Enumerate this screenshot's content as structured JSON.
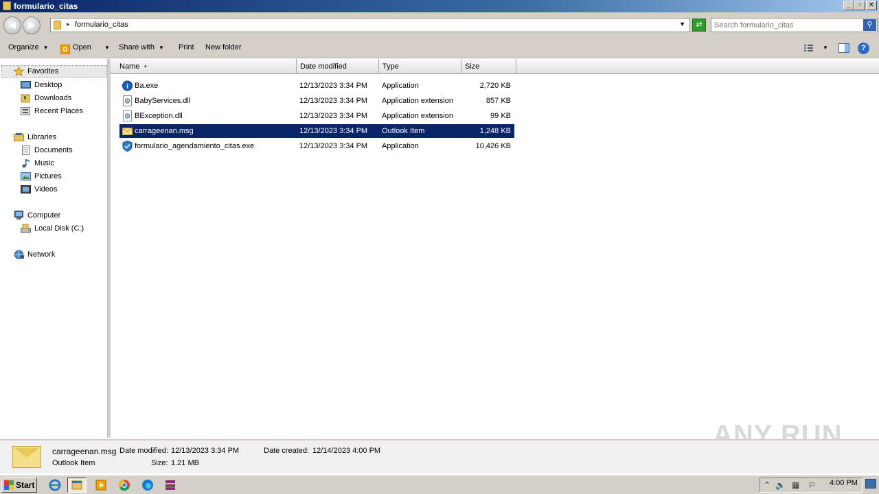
{
  "window": {
    "title": "formulario_citas",
    "buttons": {
      "minimize": "_",
      "restore": "▫",
      "close": "✕"
    }
  },
  "addressbar": {
    "path": "formulario_citas",
    "search_placeholder": "Search formulario_citas"
  },
  "toolbar": {
    "organize": "Organize",
    "open": "Open",
    "share_with": "Share with",
    "print": "Print",
    "new_folder": "New folder"
  },
  "navpane": {
    "favorites": {
      "label": "Favorites",
      "items": [
        "Desktop",
        "Downloads",
        "Recent Places"
      ]
    },
    "libraries": {
      "label": "Libraries",
      "items": [
        "Documents",
        "Music",
        "Pictures",
        "Videos"
      ]
    },
    "computer": {
      "label": "Computer",
      "items": [
        "Local Disk (C:)"
      ]
    },
    "network": {
      "label": "Network"
    }
  },
  "columns": [
    "Name",
    "Date modified",
    "Type",
    "Size"
  ],
  "files": [
    {
      "name": "Ba.exe",
      "date": "12/13/2023 3:34 PM",
      "type": "Application",
      "size": "2,720 KB",
      "icon": "exe-blue-icon"
    },
    {
      "name": "BabyServices.dll",
      "date": "12/13/2023 3:34 PM",
      "type": "Application extension",
      "size": "857 KB",
      "icon": "dll-icon"
    },
    {
      "name": "BException.dll",
      "date": "12/13/2023 3:34 PM",
      "type": "Application extension",
      "size": "99 KB",
      "icon": "dll-icon"
    },
    {
      "name": "carrageenan.msg",
      "date": "12/13/2023 3:34 PM",
      "type": "Outlook Item",
      "size": "1,248 KB",
      "icon": "mail-icon",
      "selected": true
    },
    {
      "name": "formulario_agendamiento_citas.exe",
      "date": "12/13/2023 3:34 PM",
      "type": "Application",
      "size": "10,426 KB",
      "icon": "shield-icon"
    }
  ],
  "details": {
    "filename": "carrageenan.msg",
    "type": "Outlook Item",
    "date_modified_label": "Date modified:",
    "date_modified": "12/13/2023 3:34 PM",
    "date_created_label": "Date created:",
    "date_created": "12/14/2023 4:00 PM",
    "size_label": "Size:",
    "size": "1.21 MB"
  },
  "watermark": "ANY RUN",
  "taskbar": {
    "start": "Start",
    "clock": "4:00 PM"
  },
  "colors": {
    "selection": "#0a246a",
    "chrome": "#d4d0c8"
  }
}
